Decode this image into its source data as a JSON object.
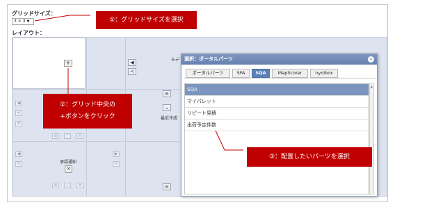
{
  "grid_size": {
    "label": "グリッドサイズ：",
    "selected": "3 × 3"
  },
  "layout": {
    "label": "レイアウト："
  },
  "cells": {
    "mode_text": "モデ",
    "recent_text": "最近作成",
    "approval_text": "承認通知"
  },
  "dialog": {
    "title": "選択：ポータルパーツ",
    "tabs": [
      {
        "label": "ポータルパーツ",
        "active": false
      },
      {
        "label": "SFA",
        "active": false
      },
      {
        "label": "SQA",
        "active": true
      },
      {
        "label": "MapScorer",
        "active": false
      },
      {
        "label": "nyoibox",
        "active": false
      }
    ],
    "items": [
      {
        "label": "SQA",
        "selected": true
      },
      {
        "label": "マイパレット",
        "selected": false
      },
      {
        "label": "リピート見積",
        "selected": false
      },
      {
        "label": "出荷予定件数",
        "selected": false
      }
    ]
  },
  "annotations": {
    "step1": "①：グリッドサイズを選択",
    "step2_line1": "②：グリッド中央の",
    "step2_line2": "+ボタンをクリック",
    "step3": "③：配置したいパーツを選択"
  },
  "colors": {
    "annotation": "#c00000",
    "accent": "#5b7fb7",
    "selected_row": "#7b94c0"
  }
}
